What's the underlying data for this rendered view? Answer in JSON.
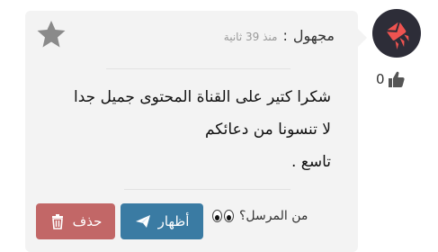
{
  "comment": {
    "author": "مجهول",
    "separator": ":",
    "time": "منذ 39 ثانية",
    "lines": [
      "شكرا كتير على القناة المحتوى جميل جدا",
      "لا تنسونا من دعائكم",
      "تاسع ."
    ],
    "likes": "0",
    "sender_label": "من المرسل؟",
    "show_button": "أظهار",
    "delete_button": "حذف"
  },
  "icons": {
    "avatar": "rocket-logo-icon",
    "like": "thumbs-up-icon",
    "favorite": "star-icon",
    "sender": "eyes-icon",
    "show": "paper-plane-icon",
    "delete": "trash-icon"
  },
  "colors": {
    "show_button": "#3a7ba3",
    "delete_button": "#c26767",
    "card_background": "#f3f3f3",
    "avatar_background": "#2d2d38",
    "avatar_accent": "#ef5350"
  }
}
